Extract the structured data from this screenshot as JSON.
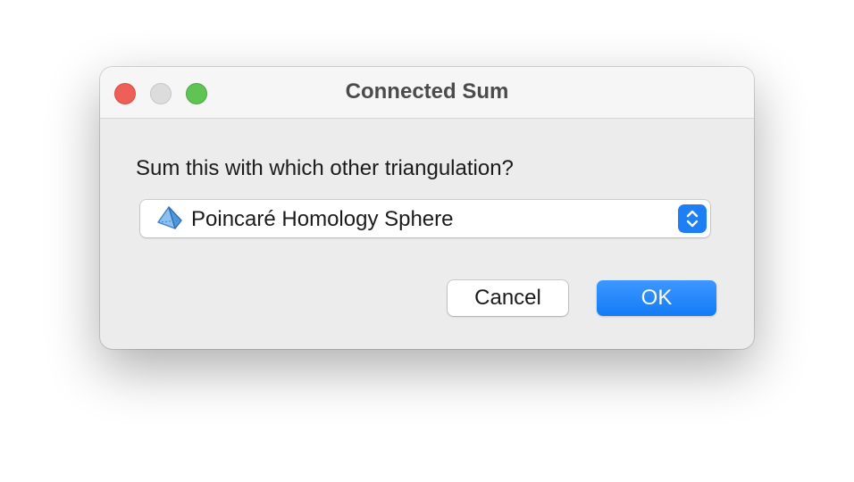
{
  "window": {
    "title": "Connected Sum"
  },
  "dialog": {
    "prompt": "Sum this with which other triangulation?",
    "selected_triangulation": "Poincaré Homology Sphere",
    "popup_icon": "tetrahedron-icon",
    "stepper_icon": "chevron-up-down-icon"
  },
  "buttons": {
    "cancel_label": "Cancel",
    "ok_label": "OK"
  },
  "colors": {
    "close": "#ee5f57",
    "minimize": "#dcdcdc",
    "zoom": "#5fc453",
    "accent": "#1e7ff5"
  }
}
